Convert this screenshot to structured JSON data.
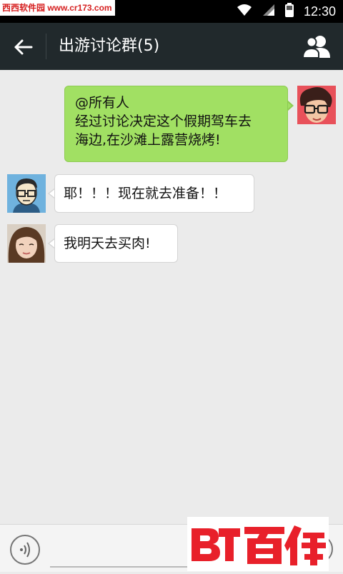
{
  "status_bar": {
    "watermark": "西西软件园 www.cr173.com",
    "time": "12:30"
  },
  "header": {
    "title": "出游讨论群(5)"
  },
  "messages": [
    {
      "direction": "outgoing",
      "lines": [
        "@所有人",
        "经过讨论决定这个假期驾车去",
        "海边,在沙滩上露营烧烤!"
      ]
    },
    {
      "direction": "incoming",
      "lines": [
        "耶！！！现在就去准备！！"
      ]
    },
    {
      "direction": "incoming",
      "lines": [
        "我明天去买肉!"
      ]
    }
  ],
  "input": {
    "value": "",
    "placeholder": ""
  },
  "watermark_logo": "百佳",
  "colors": {
    "title_bar": "#21292c",
    "outgoing_bubble": "#a1e063",
    "incoming_bubble": "#ffffff",
    "chat_background": "#ebebeb",
    "logo_red": "#e8202a"
  }
}
